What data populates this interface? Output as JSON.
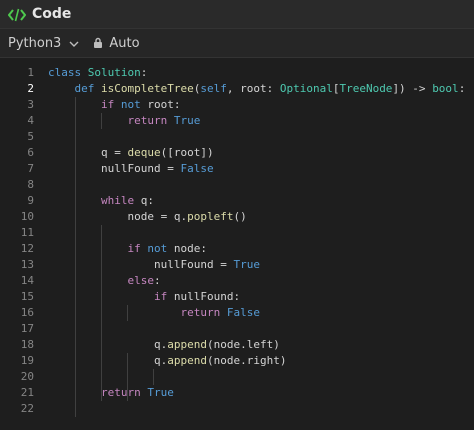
{
  "header": {
    "title": "Code"
  },
  "toolbar": {
    "language": "Python3",
    "mode": "Auto"
  },
  "editor": {
    "line_numbers": [
      "1",
      "2",
      "3",
      "4",
      "5",
      "6",
      "7",
      "8",
      "9",
      "10",
      "11",
      "12",
      "13",
      "14",
      "15",
      "16",
      "17",
      "18",
      "19",
      "20",
      "21",
      "22"
    ],
    "active_line": "2",
    "code_lines": [
      "class Solution:",
      "    def isCompleteTree(self, root: Optional[TreeNode]) -> bool:",
      "        if not root:",
      "            return True",
      "",
      "        q = deque([root])",
      "        nullFound = False",
      "",
      "        while q:",
      "            node = q.popleft()",
      "",
      "            if not node:",
      "                nullFound = True",
      "            else:",
      "                if nullFound:",
      "                    return False",
      "",
      "                q.append(node.left)",
      "                q.append(node.right)",
      "",
      "        return True",
      ""
    ]
  }
}
